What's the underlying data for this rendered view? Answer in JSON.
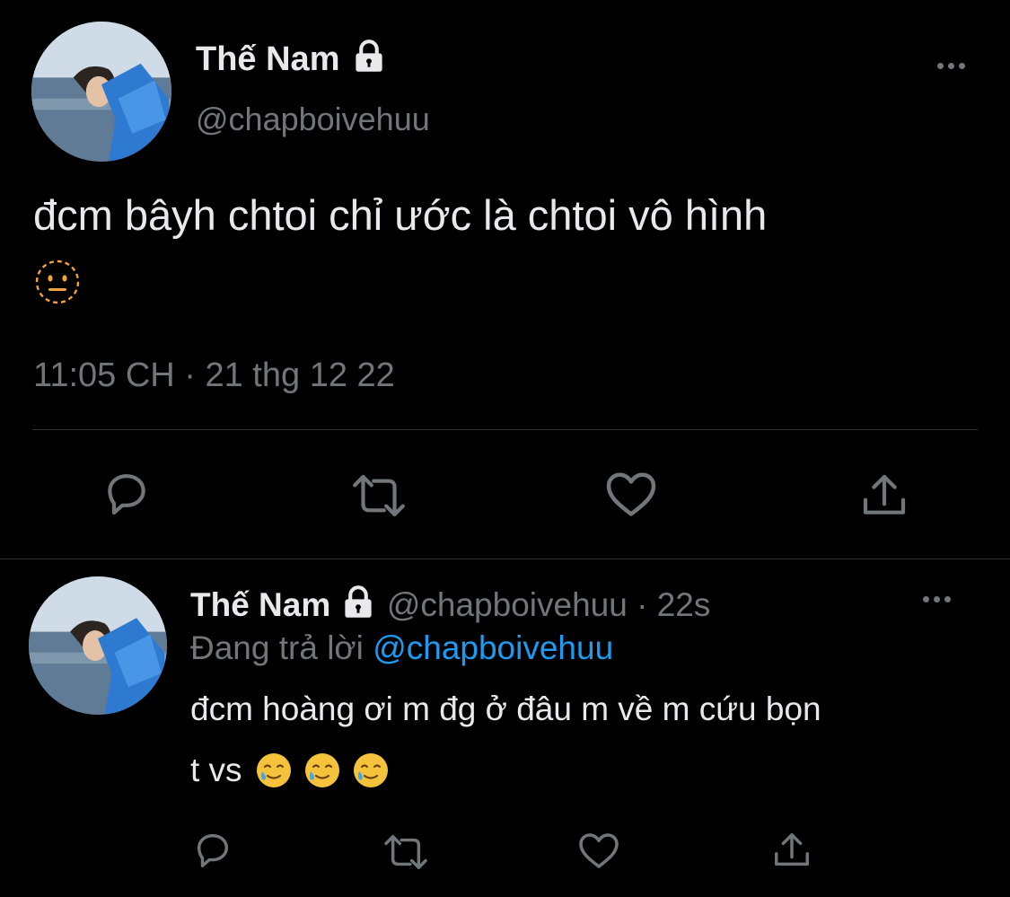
{
  "main_tweet": {
    "display_name": "Thế Nam",
    "handle": "@chapboivehuu",
    "text": "đcm bâyh chtoi chỉ ước là chtoi vô hình",
    "emoji_icon": "neutral-face-dotted-icon",
    "timestamp": "11:05 CH · 21 thg 12 22",
    "actions": [
      "reply-icon",
      "retweet-icon",
      "like-icon",
      "share-icon"
    ]
  },
  "reply_tweet": {
    "display_name": "Thế Nam",
    "handle": "@chapboivehuu",
    "separator": "·",
    "time_ago": "22s",
    "replying_prefix": "Đang trả lời",
    "replying_to": "@chapboivehuu",
    "text_line1": "đcm hoàng ơi m đg ở đâu m về m cứu bọn",
    "text_line2": "t vs",
    "emoji_icons": [
      "smiling-face-with-tear-icon",
      "smiling-face-with-tear-icon",
      "smiling-face-with-tear-icon"
    ],
    "actions": [
      "reply-icon",
      "retweet-icon",
      "like-icon",
      "share-icon"
    ]
  },
  "colors": {
    "background": "#000000",
    "text": "#e7e9ea",
    "muted": "#71767b",
    "link": "#1d9bf0",
    "divider": "#2f3336"
  }
}
